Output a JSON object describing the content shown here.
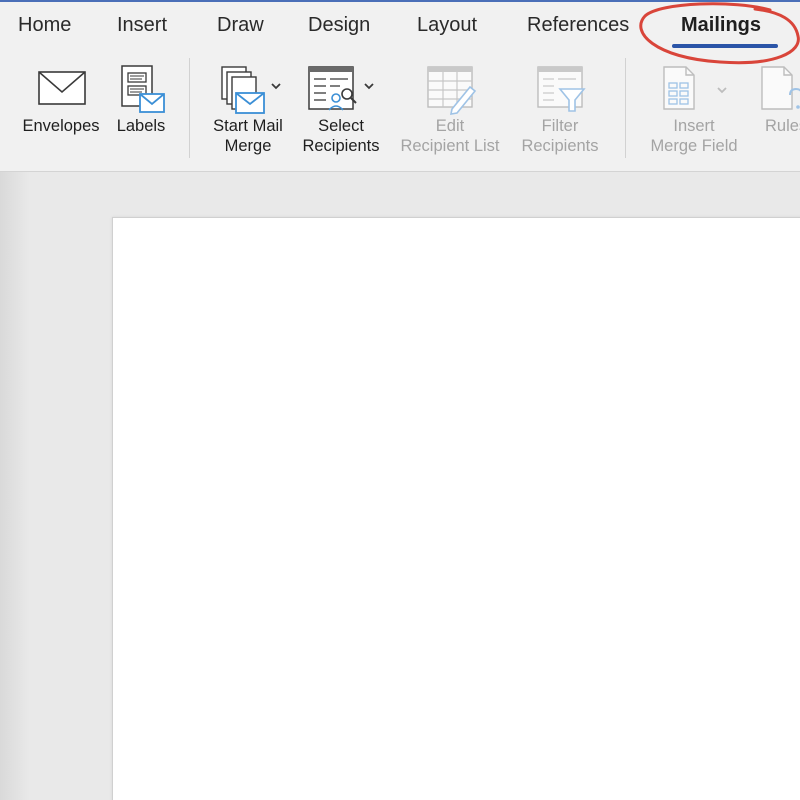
{
  "tabs": [
    {
      "label": "Home"
    },
    {
      "label": "Insert"
    },
    {
      "label": "Draw"
    },
    {
      "label": "Design"
    },
    {
      "label": "Layout"
    },
    {
      "label": "References"
    },
    {
      "label": "Mailings",
      "active": true
    }
  ],
  "ribbon": {
    "envelopes": {
      "label": "Envelopes"
    },
    "labels": {
      "label": "Labels"
    },
    "start_mail_merge": {
      "line1": "Start Mail",
      "line2": "Merge"
    },
    "select_recipients": {
      "line1": "Select",
      "line2": "Recipients"
    },
    "edit_recipient_list": {
      "line1": "Edit",
      "line2": "Recipient List",
      "disabled": true
    },
    "filter_recipients": {
      "line1": "Filter",
      "line2": "Recipients",
      "disabled": true
    },
    "insert_merge_field": {
      "line1": "Insert",
      "line2": "Merge Field",
      "disabled": true
    },
    "rules": {
      "line1": "Rules",
      "disabled": true
    }
  },
  "colors": {
    "accent": "#2b55a8",
    "annotation": "#d9453a",
    "disabled_text": "#a4a4a4",
    "envelope_blue": "#3b8fd6"
  },
  "icons": {
    "envelopes": "envelope-icon",
    "labels": "labels-icon",
    "start_mail_merge": "mail-merge-icon",
    "select_recipients": "recipients-icon",
    "edit_recipient_list": "edit-list-icon",
    "filter_recipients": "filter-icon",
    "insert_merge_field": "merge-field-icon",
    "rules": "rules-icon"
  }
}
